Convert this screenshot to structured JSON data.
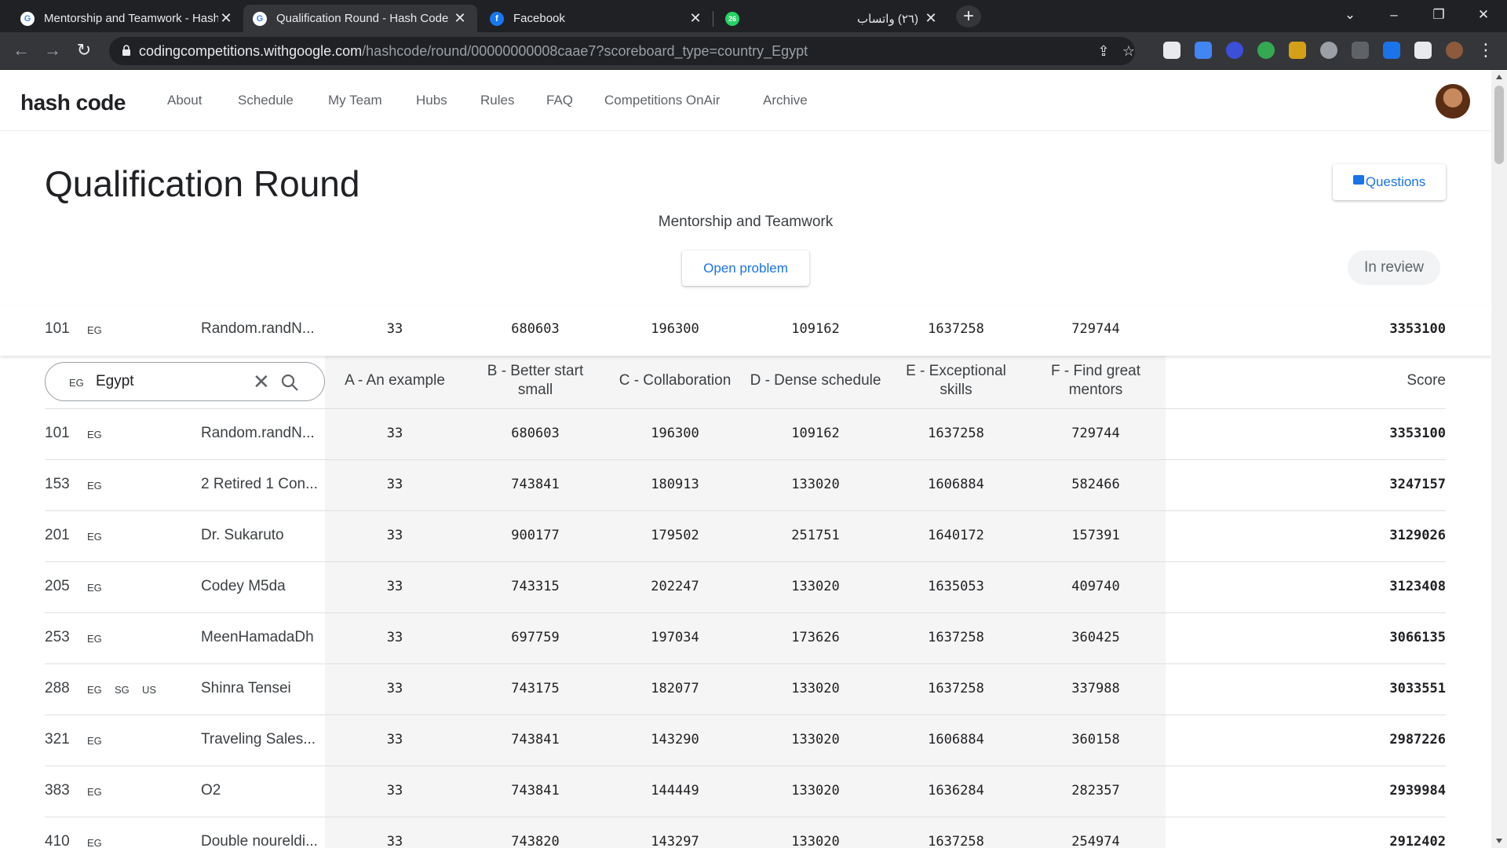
{
  "browser": {
    "tabs": [
      {
        "title": "Mentorship and Teamwork - Hash",
        "icon": "google-icon"
      },
      {
        "title": "Qualification Round - Hash Code",
        "icon": "google-icon"
      },
      {
        "title": "Facebook",
        "icon": "facebook-icon"
      },
      {
        "title": "(٢٦) واتساب",
        "icon": "whatsapp-icon",
        "badge": "26"
      }
    ],
    "url_host": "codingcompetitions.withgoogle.com",
    "url_path": "/hashcode/round/00000000008caae7?scoreboard_type=country_Egypt"
  },
  "site": {
    "brand": "hash code",
    "nav": [
      "About",
      "Schedule",
      "My Team",
      "Hubs",
      "Rules",
      "FAQ",
      "Competitions OnAir",
      "Archive"
    ]
  },
  "round": {
    "title": "Qualification Round",
    "questions_label": "Questions",
    "problem_name": "Mentorship and Teamwork",
    "open_problem_label": "Open problem",
    "status": "In review"
  },
  "filter": {
    "country_code": "EG",
    "value": "Egypt"
  },
  "columns": [
    "A - An example",
    "B - Better start small",
    "C - Collaboration",
    "D - Dense schedule",
    "E - Exceptional skills",
    "F - Find great mentors",
    "Score"
  ],
  "own_team": {
    "rank": "101",
    "countries": [
      "EG"
    ],
    "team": "Random.randN...",
    "scores": [
      "33",
      "680603",
      "196300",
      "109162",
      "1637258",
      "729744"
    ],
    "total": "3353100"
  },
  "rows": [
    {
      "rank": "101",
      "countries": [
        "EG"
      ],
      "team": "Random.randN...",
      "scores": [
        "33",
        "680603",
        "196300",
        "109162",
        "1637258",
        "729744"
      ],
      "total": "3353100"
    },
    {
      "rank": "153",
      "countries": [
        "EG"
      ],
      "team": "2 Retired 1 Con...",
      "scores": [
        "33",
        "743841",
        "180913",
        "133020",
        "1606884",
        "582466"
      ],
      "total": "3247157"
    },
    {
      "rank": "201",
      "countries": [
        "EG"
      ],
      "team": "Dr. Sukaruto",
      "scores": [
        "33",
        "900177",
        "179502",
        "251751",
        "1640172",
        "157391"
      ],
      "total": "3129026"
    },
    {
      "rank": "205",
      "countries": [
        "EG"
      ],
      "team": "Codey M5da",
      "scores": [
        "33",
        "743315",
        "202247",
        "133020",
        "1635053",
        "409740"
      ],
      "total": "3123408"
    },
    {
      "rank": "253",
      "countries": [
        "EG"
      ],
      "team": "MeenHamadaDh",
      "scores": [
        "33",
        "697759",
        "197034",
        "173626",
        "1637258",
        "360425"
      ],
      "total": "3066135"
    },
    {
      "rank": "288",
      "countries": [
        "EG",
        "SG",
        "US"
      ],
      "team": "Shinra Tensei",
      "scores": [
        "33",
        "743175",
        "182077",
        "133020",
        "1637258",
        "337988"
      ],
      "total": "3033551"
    },
    {
      "rank": "321",
      "countries": [
        "EG"
      ],
      "team": "Traveling Sales...",
      "scores": [
        "33",
        "743841",
        "143290",
        "133020",
        "1606884",
        "360158"
      ],
      "total": "2987226"
    },
    {
      "rank": "383",
      "countries": [
        "EG"
      ],
      "team": "O2",
      "scores": [
        "33",
        "743841",
        "144449",
        "133020",
        "1636284",
        "282357"
      ],
      "total": "2939984"
    },
    {
      "rank": "410",
      "countries": [
        "EG"
      ],
      "team": "Double noureldi...",
      "scores": [
        "33",
        "743820",
        "143297",
        "133020",
        "1637258",
        "254974"
      ],
      "total": "2912402"
    }
  ],
  "colors": {
    "accent": "#1a73e8",
    "chrome_dark": "#202124",
    "chrome_mid": "#35363a"
  }
}
